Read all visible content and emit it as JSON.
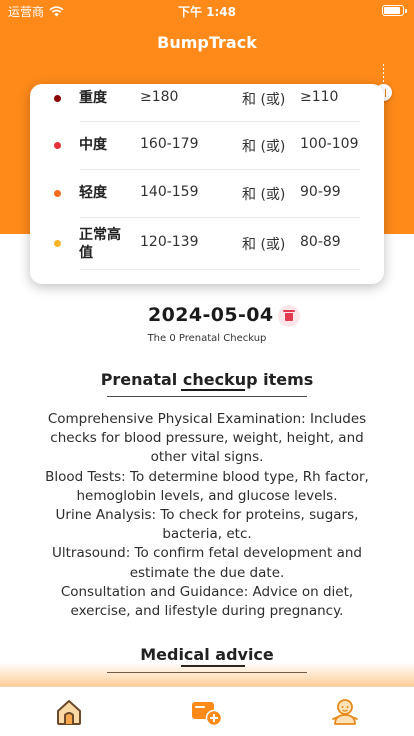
{
  "status_bar": {
    "carrier": "运营商",
    "time": "下午 1:48",
    "battery_level": 0.9
  },
  "app": {
    "title": "BumpTrack"
  },
  "bp_table": {
    "connector": "和 (或)",
    "rows": [
      {
        "level": "重度",
        "systolic": "≥180",
        "diastolic": "≥110",
        "dot_color": "#8b0000"
      },
      {
        "level": "中度",
        "systolic": "160-179",
        "diastolic": "100-109",
        "dot_color": "#e8313d"
      },
      {
        "level": "轻度",
        "systolic": "140-159",
        "diastolic": "90-99",
        "dot_color": "#f36b1c"
      },
      {
        "level": "正常高值",
        "systolic": "120-139",
        "diastolic": "80-89",
        "dot_color": "#f7b429"
      }
    ]
  },
  "checkup": {
    "date": "2024-05-04",
    "subtitle": "The 0 Prenatal Checkup",
    "items_title": "Prenatal checkup items",
    "items_text": [
      "Comprehensive Physical Examination: Includes checks for blood pressure, weight, height, and other vital signs.",
      "Blood Tests: To determine blood type, Rh factor, hemoglobin levels, and glucose levels.",
      "Urine Analysis: To check for proteins, sugars, bacteria, etc.",
      "Ultrasound: To confirm fetal development and estimate the due date.",
      "Consultation and Guidance: Advice on diet, exercise, and lifestyle during pregnancy."
    ],
    "advice_title": "Medical advice"
  },
  "icons": {
    "signal": "cellular-signal-icon",
    "wifi": "wifi-icon",
    "battery": "battery-icon",
    "scroll": "scroll-handle-icon",
    "delete": "trash-icon",
    "tab_home": "home-icon",
    "tab_add": "add-checkup-icon",
    "tab_baby": "baby-icon"
  },
  "colors": {
    "primary": "#ff8a1a",
    "delete_bg": "#fde6ea",
    "delete_icon": "#e23a4f"
  }
}
